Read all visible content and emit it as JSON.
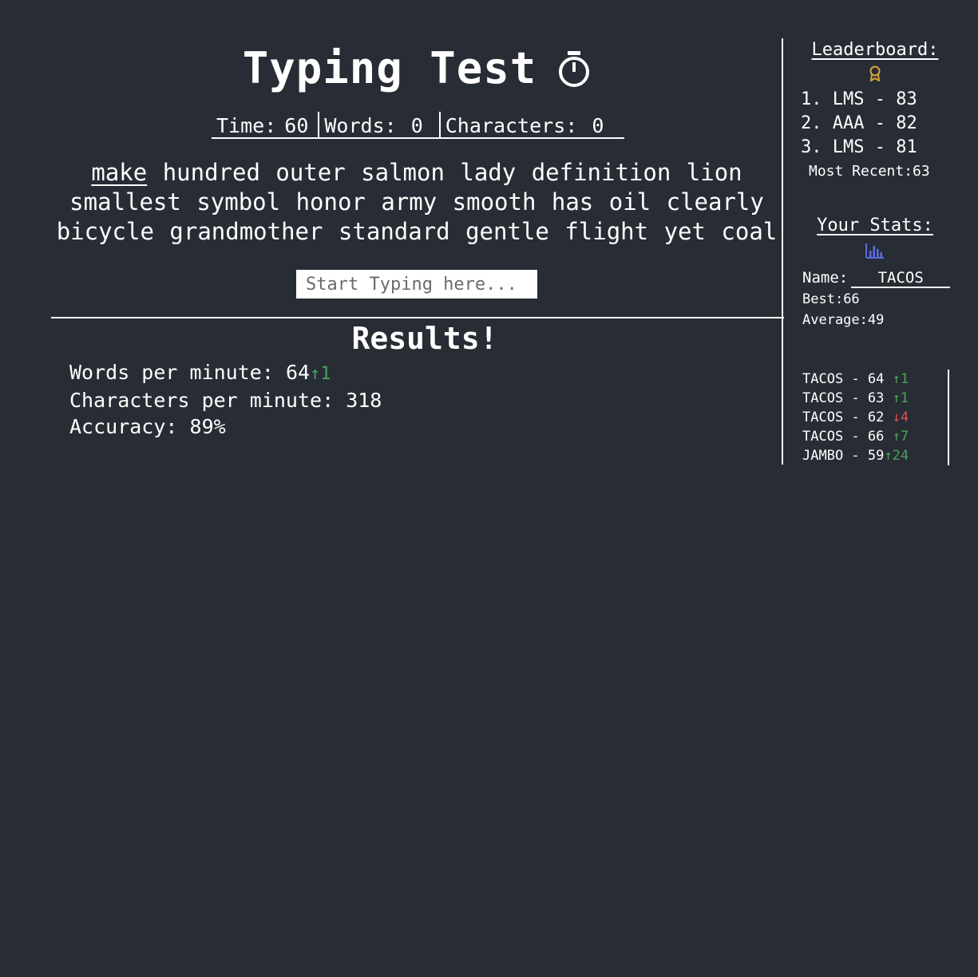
{
  "app": {
    "title": "Typing Test",
    "icon": "stopwatch-icon"
  },
  "counters": {
    "time_label": "Time:",
    "time_value": "60",
    "words_label": "Words:",
    "words_value": "0",
    "chars_label": "Characters:",
    "chars_value": "0"
  },
  "words": [
    "make",
    "hundred",
    "outer",
    "salmon",
    "lady",
    "definition",
    "lion",
    "smallest",
    "symbol",
    "honor",
    "army",
    "smooth",
    "has",
    "oil",
    "clearly",
    "bicycle",
    "grandmother",
    "standard",
    "gentle",
    "flight",
    "yet",
    "coal"
  ],
  "current_word_index": 0,
  "input": {
    "placeholder": "Start Typing here...",
    "value": ""
  },
  "results": {
    "title": "Results!",
    "wpm_label": "Words per minute:",
    "wpm_value": "64",
    "wpm_delta": "↑1",
    "cpm_label": "Characters per minute:",
    "cpm_value": "318",
    "accuracy_label": "Accuracy:",
    "accuracy_value": "89%"
  },
  "leaderboard": {
    "heading": "Leaderboard:",
    "icon": "award-icon",
    "entries": [
      "1. LMS - 83",
      "2. AAA - 82",
      "3. LMS - 81"
    ],
    "recent_label": "Most Recent:",
    "recent_value": "63"
  },
  "stats": {
    "heading": "Your Stats:",
    "icon": "bar-chart-icon",
    "name_label": "Name:",
    "name_value": "TACOS",
    "best_label": "Best:",
    "best_value": "66",
    "average_label": "Average:",
    "average_value": "49"
  },
  "history": [
    {
      "entry": "TACOS - 64 ",
      "delta": "↑1",
      "dir": "up"
    },
    {
      "entry": "TACOS - 63 ",
      "delta": "↑1",
      "dir": "up"
    },
    {
      "entry": "TACOS - 62 ",
      "delta": "↓4",
      "dir": "down"
    },
    {
      "entry": "TACOS - 66 ",
      "delta": "↑7",
      "dir": "up"
    },
    {
      "entry": "JAMBO - 59",
      "delta": "↑24",
      "dir": "up"
    }
  ],
  "colors": {
    "background": "#282c34",
    "up": "#4aa35a",
    "down": "#d9534f",
    "award": "#d4a73a",
    "chart_icon": "#5b6ee1"
  }
}
